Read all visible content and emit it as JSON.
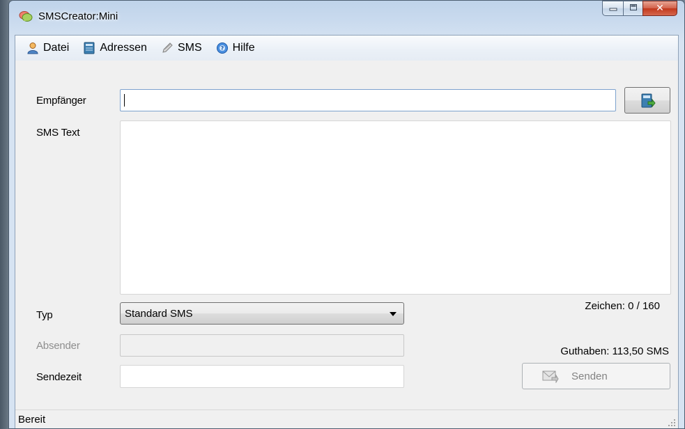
{
  "window": {
    "title": "SMSCreator:Mini",
    "caption_buttons": [
      "minimize-icon",
      "maximize-icon",
      "close-icon"
    ]
  },
  "menu": {
    "items": [
      {
        "label": "Datei",
        "icon": "user-icon"
      },
      {
        "label": "Adressen",
        "icon": "address-book-icon"
      },
      {
        "label": "SMS",
        "icon": "pencil-icon"
      },
      {
        "label": "Hilfe",
        "icon": "help-icon"
      }
    ]
  },
  "form": {
    "recipient_label": "Empfänger",
    "recipient_value": "",
    "sms_text_label": "SMS Text",
    "sms_text_value": "",
    "type_label": "Typ",
    "type_selected": "Standard SMS",
    "sender_label": "Absender",
    "sender_value": "",
    "send_time_label": "Sendezeit",
    "send_time_value": ""
  },
  "info": {
    "chars": "Zeichen: 0 / 160",
    "balance": "Guthaben: 113,50 SMS"
  },
  "buttons": {
    "send_label": "Senden"
  },
  "status": {
    "text": "Bereit"
  },
  "colors": {
    "close_button": "#c2381c",
    "accent": "#3c7fb1"
  }
}
